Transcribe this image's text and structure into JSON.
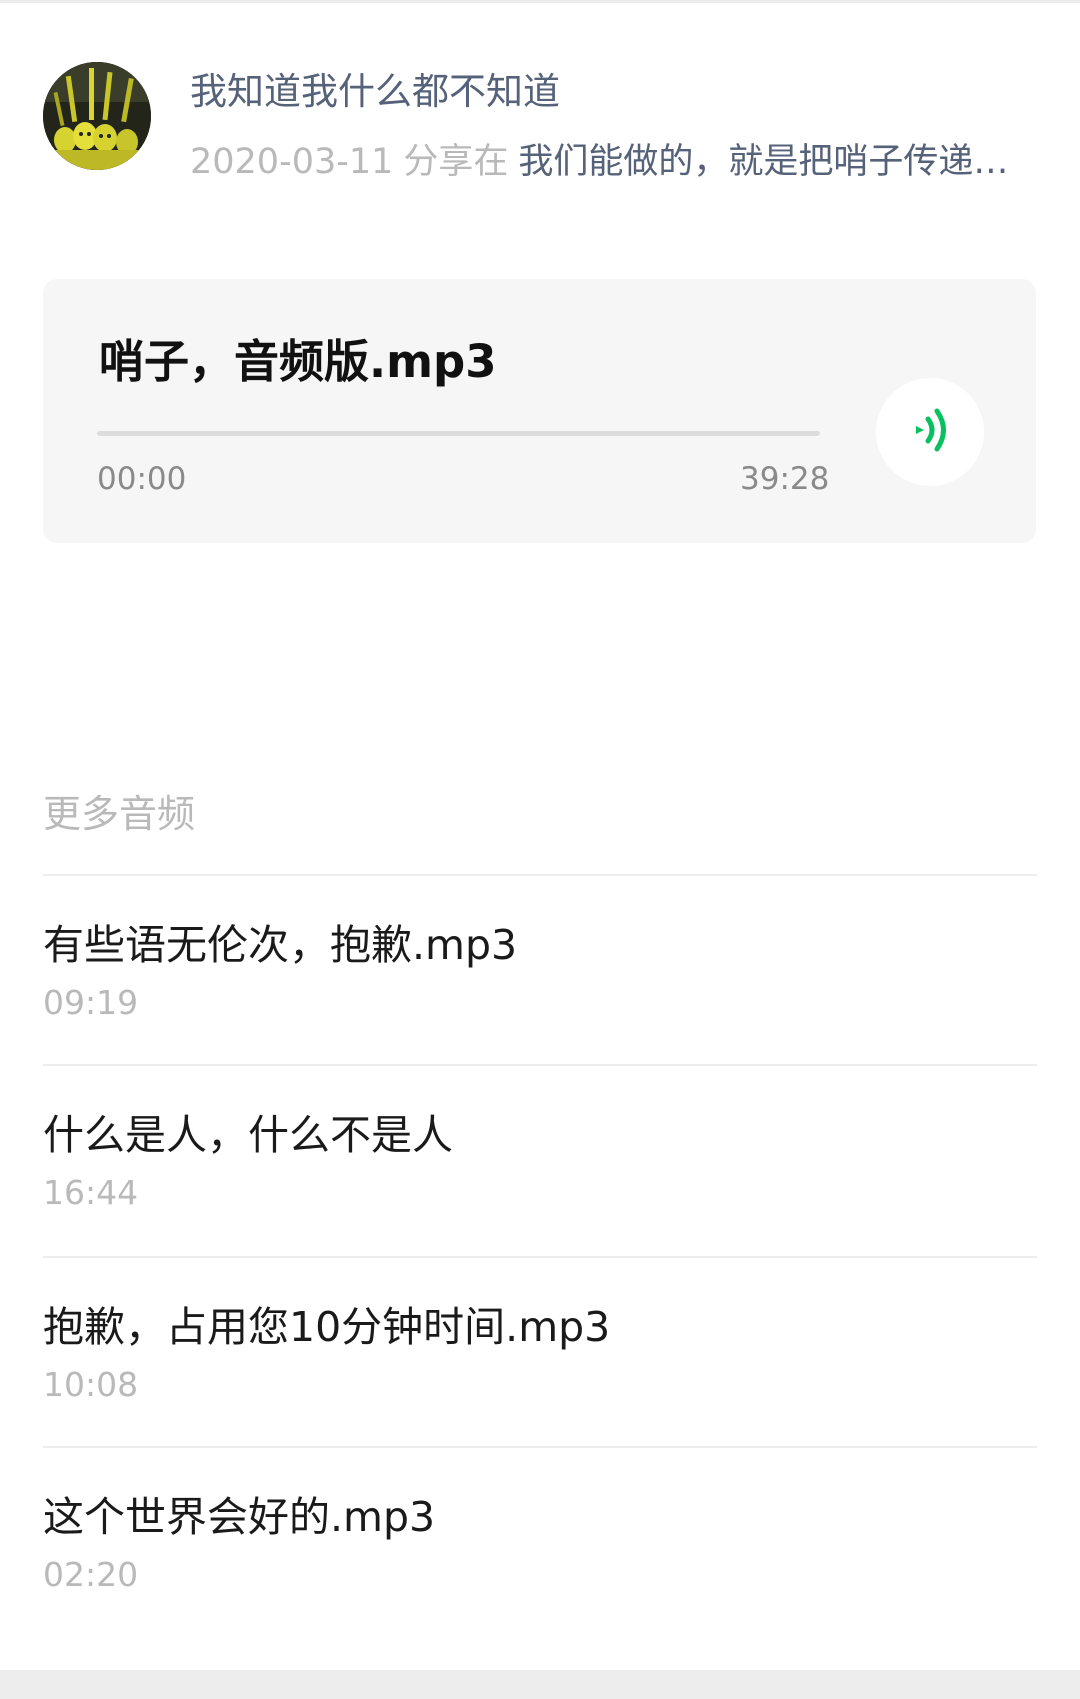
{
  "header": {
    "author": "我知道我什么都不知道",
    "date": "2020-03-11",
    "share_label": "分享在",
    "topic": "我们能做的，就是把哨子传递…"
  },
  "player": {
    "title": "哨子，音频版.mp3",
    "current_time": "00:00",
    "total_time": "39:28",
    "progress_fraction": 0,
    "icon": "audio-playing-icon",
    "accent_color": "#07c160"
  },
  "more_audio": {
    "section_title": "更多音频",
    "items": [
      {
        "title": "有些语无伦次，抱歉.mp3",
        "duration": "09:19"
      },
      {
        "title": "什么是人，什么不是人",
        "duration": "16:44"
      },
      {
        "title": "抱歉，占用您10分钟时间.mp3",
        "duration": "10:08"
      },
      {
        "title": "这个世界会好的.mp3",
        "duration": "02:20"
      }
    ]
  }
}
